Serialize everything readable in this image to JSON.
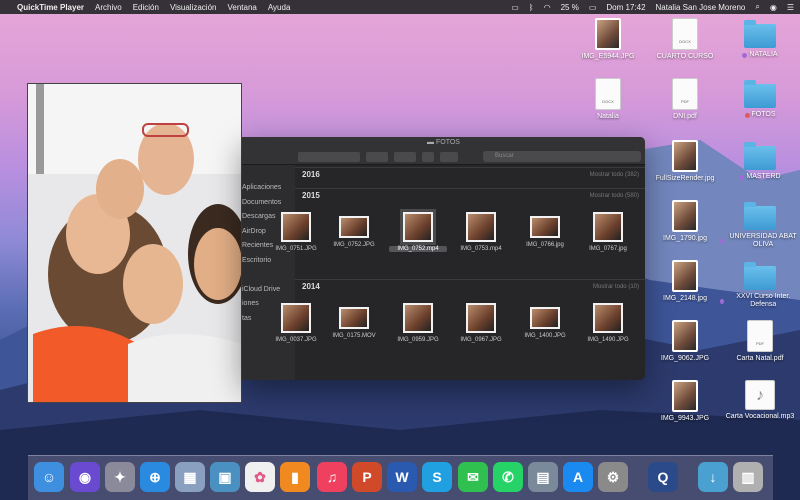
{
  "menubar": {
    "app_name": "QuickTime Player",
    "menus": [
      "Archivo",
      "Edición",
      "Visualización",
      "Ventana",
      "Ayuda"
    ],
    "battery": "25 %",
    "clock": "Dom 17:42",
    "user": "Natalia San Jose Moreno"
  },
  "desktop_icons": [
    {
      "label": "IMG_E5944.JPG",
      "kind": "photo"
    },
    {
      "label": "CUARTO CURSO",
      "kind": "doc",
      "ext": "DOCX"
    },
    {
      "label": "NATALIA",
      "kind": "folder",
      "tag": "#a06ad6"
    },
    {
      "label": "Natalia",
      "kind": "doc",
      "ext": "DOCX"
    },
    {
      "label": "DNI.pdf",
      "kind": "doc",
      "ext": "PDF"
    },
    {
      "label": "FOTOS",
      "kind": "folder",
      "tag": "#e05a5a"
    },
    {
      "label": "FullSizeRender.jpg",
      "kind": "photo"
    },
    {
      "label": "MASTERD",
      "kind": "folder",
      "tag": "#a06ad6"
    },
    {
      "label": "IMG_1790.jpg",
      "kind": "photo"
    },
    {
      "label": "UNIVERSIDAD ABAT OLIVA",
      "kind": "folder",
      "tag": "#a06ad6"
    },
    {
      "label": "IMG_2148.jpg",
      "kind": "photo"
    },
    {
      "label": "XXVI Curso Inter. Defensa",
      "kind": "folder",
      "tag": "#a06ad6"
    },
    {
      "label": "IMG_9062.JPG",
      "kind": "photo"
    },
    {
      "label": "Carta Natal.pdf",
      "kind": "doc",
      "ext": "PDF"
    },
    {
      "label": "IMG_9943.JPG",
      "kind": "photo"
    },
    {
      "label": "Carta Vocacional.mp3",
      "kind": "audio"
    }
  ],
  "finder": {
    "title": "FOTOS",
    "search_placeholder": "Buscar",
    "sidebar": [
      "Aplicaciones",
      "Documentos",
      "Descargas",
      "AirDrop",
      "Recientes",
      "Escritorio",
      "",
      "iCloud Drive",
      "iones",
      "tas"
    ],
    "sections": [
      {
        "year": "2016",
        "show_all": "Mostrar todo (382)",
        "items": []
      },
      {
        "year": "2015",
        "show_all": "Mostrar todo (580)",
        "items": [
          "IMG_0751.JPG",
          "IMG_0752.JPG",
          "IMG_0752.mp4",
          "IMG_0753.mp4",
          "IMG_0766.jpg",
          "IMG_0767.jpg"
        ]
      },
      {
        "year": "2014",
        "show_all": "Mostrar todo (10)",
        "items": [
          "IMG_0037.JPG",
          "IMG_0175.MOV",
          "IMG_0959.JPG",
          "IMG_0967.JPG",
          "IMG_1400.JPG",
          "IMG_1490.JPG"
        ]
      }
    ],
    "selected_item": "IMG_0752.mp4"
  },
  "dock": [
    "finder",
    "siri",
    "launchpad",
    "safari",
    "preview",
    "photo-viewer",
    "photos",
    "books",
    "music",
    "powerpoint",
    "word",
    "skype",
    "messages",
    "whatsapp",
    "image-capture",
    "app-store",
    "system-preferences",
    "quicktime",
    "downloads",
    "trash"
  ]
}
